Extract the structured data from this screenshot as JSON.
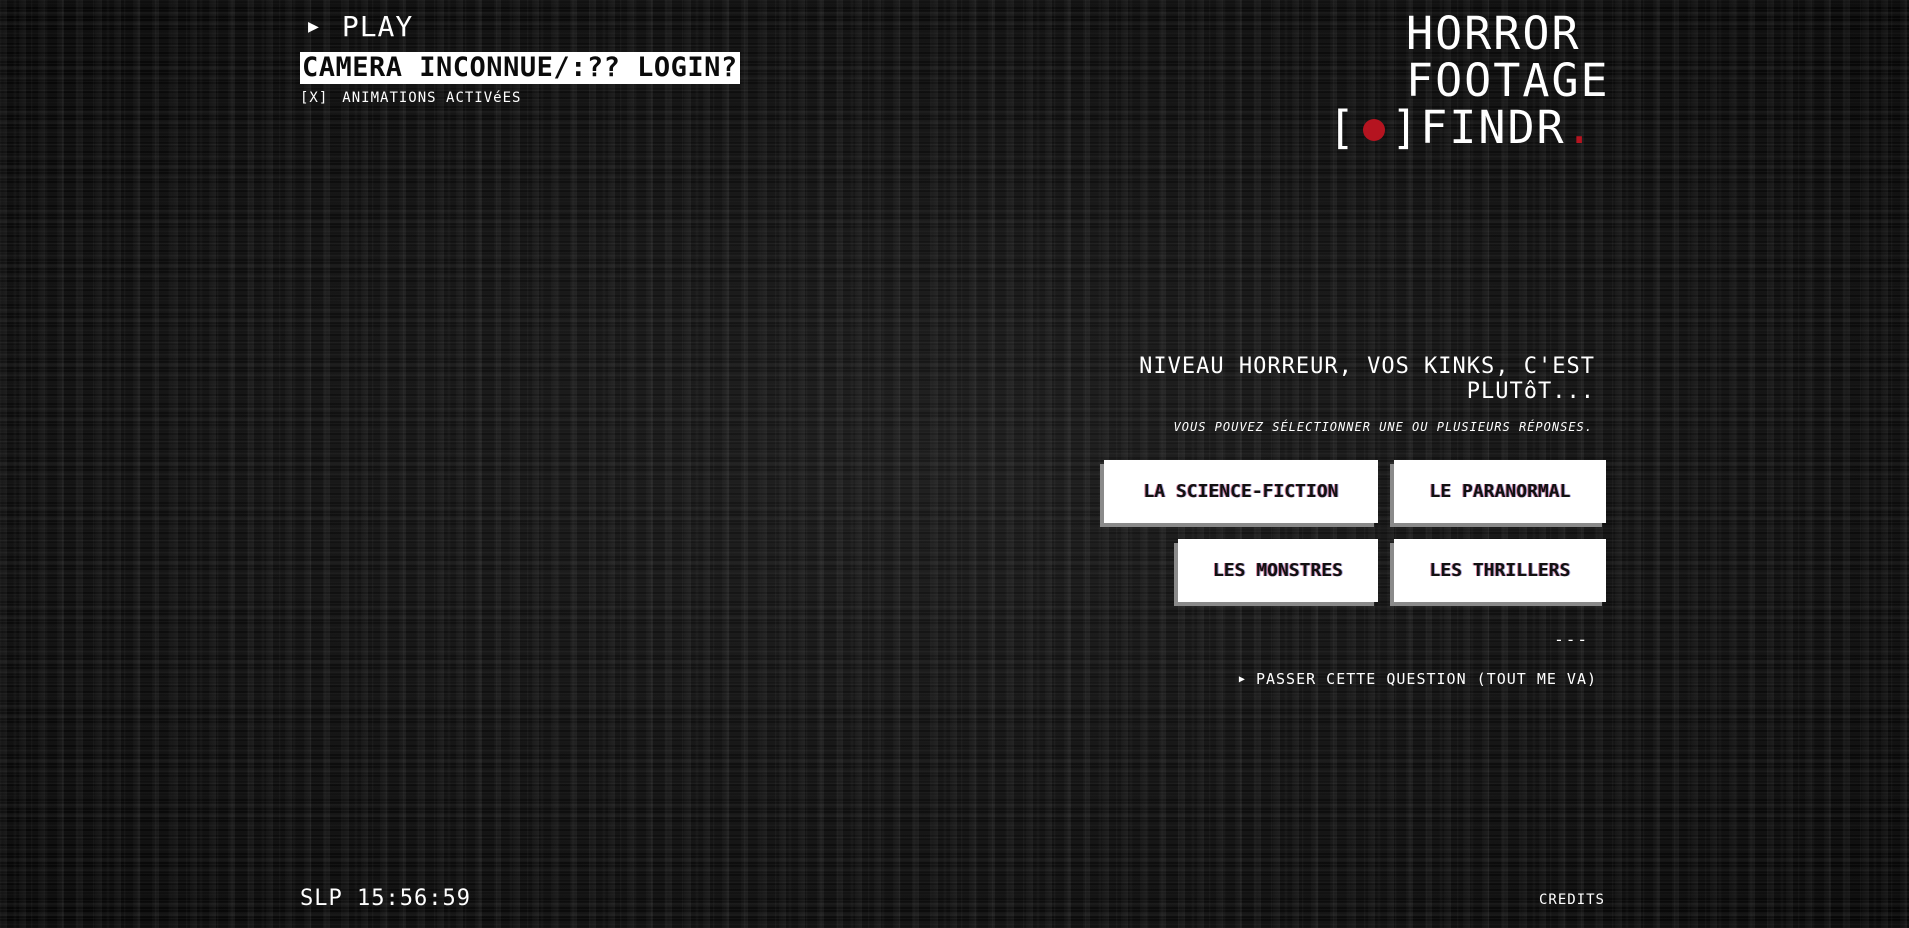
{
  "hud": {
    "play_label": "PLAY",
    "camera_label": "CAMERA INCONNUE/:?? LOGIN?",
    "animations_checkbox": "[X]",
    "animations_label": "ANIMATIONS ACTIVéES"
  },
  "logo": {
    "line1": "HORROR",
    "line2": "FOOTAGE",
    "bracket_open": "[",
    "bracket_close": "]",
    "line3_text": "FINDR",
    "period": "."
  },
  "question": {
    "title": "NIVEAU HORREUR, VOS KINKS, C'EST PLUTôT...",
    "hint": "VOUS POUVEZ SÉLECTIONNER UNE OU PLUSIEURS RÉPONSES.",
    "answers": [
      {
        "label": "LA SCIENCE-FICTION"
      },
      {
        "label": "LE PARANORMAL"
      },
      {
        "label": "LES MONSTRES"
      },
      {
        "label": "LES THRILLERS"
      }
    ],
    "separator": "---",
    "skip_label": "PASSER CETTE QUESTION (TOUT ME VA)"
  },
  "footer": {
    "clock": "SLP 15:56:59",
    "credits_label": "CREDITS"
  },
  "colors": {
    "background": "#0b0b0b",
    "text": "#ffffff",
    "accent_red": "#b51420"
  },
  "icons": {
    "play": "play-triangle-icon",
    "rec": "record-dot-icon",
    "skip": "skip-triangle-icon"
  }
}
